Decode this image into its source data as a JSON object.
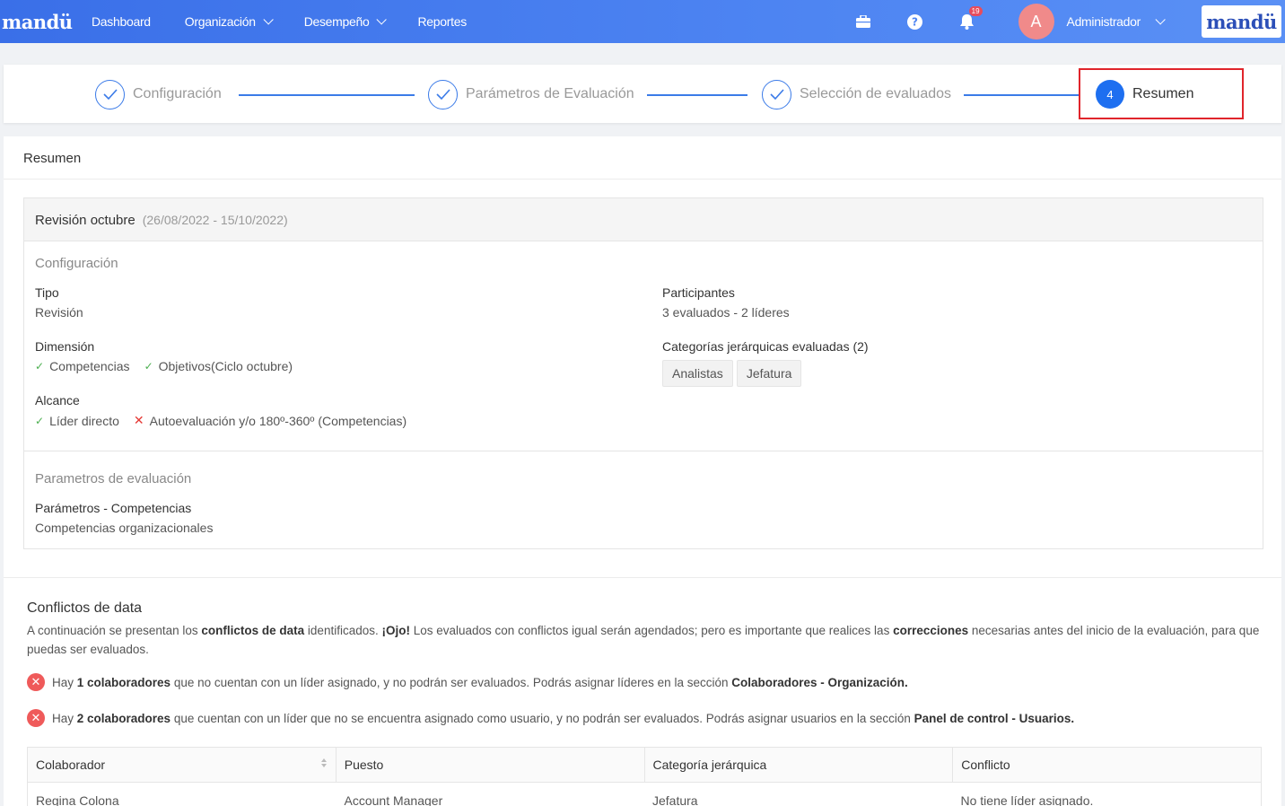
{
  "nav": {
    "brand": "mandü",
    "items": [
      {
        "label": "Dashboard",
        "dropdown": false
      },
      {
        "label": "Organización",
        "dropdown": true
      },
      {
        "label": "Desempeño",
        "dropdown": true
      },
      {
        "label": "Reportes",
        "dropdown": false
      }
    ],
    "notification_count": "19",
    "avatar_initial": "A",
    "user_name": "Administrador",
    "logo_text": "mandü"
  },
  "steps": [
    {
      "label": "Configuración",
      "state": "done"
    },
    {
      "label": "Parámetros de Evaluación",
      "state": "done"
    },
    {
      "label": "Selección de evaluados",
      "state": "done"
    },
    {
      "label": "Resumen",
      "number": "4",
      "state": "active"
    }
  ],
  "summary": {
    "title": "Resumen",
    "eval_name": "Revisión octubre",
    "eval_dates": "(26/08/2022 - 15/10/2022)",
    "config": {
      "section_title": "Configuración",
      "tipo_label": "Tipo",
      "tipo_value": "Revisión",
      "dimension_label": "Dimensión",
      "dimension_items": [
        "Competencias",
        "Objetivos(Ciclo octubre)"
      ],
      "alcance_label": "Alcance",
      "alcance_ok": "Líder directo",
      "alcance_no": "Autoevaluación y/o 180º-360º (Competencias)",
      "participantes_label": "Participantes",
      "participantes_value": "3 evaluados - 2 líderes",
      "categorias_label": "Categorías jerárquicas evaluadas (2)",
      "categorias_tags": [
        "Analistas",
        "Jefatura"
      ]
    },
    "params": {
      "section_title": "Parametros de evaluación",
      "label": "Parámetros - Competencias",
      "value": "Competencias organizacionales"
    }
  },
  "conflicts": {
    "title": "Conflictos de data",
    "desc": {
      "p1": "A continuación se presentan los ",
      "b1": "conflictos de data",
      "p2": " identificados. ",
      "b2": "¡Ojo!",
      "p3": " Los evaluados con conflictos igual serán agendados; pero es importante que realices las ",
      "b3": "correcciones",
      "p4": " necesarias antes del inicio de la evaluación, para que puedas ser evaluados."
    },
    "alert1": {
      "p1": "Hay ",
      "b1": "1 colaboradores",
      "p2": " que no cuentan con un líder asignado, y no podrán ser evaluados. Podrás asignar líderes en la sección ",
      "b2": "Colaboradores - Organización."
    },
    "alert2": {
      "p1": "Hay ",
      "b1": "2 colaboradores",
      "p2": " que cuentan con un líder que no se encuentra asignado como usuario, y no podrán ser evaluados. Podrás asignar usuarios en la sección ",
      "b2": "Panel de control - Usuarios."
    },
    "table": {
      "headers": [
        "Colaborador",
        "Puesto",
        "Categoría jerárquica",
        "Conflicto"
      ],
      "rows": [
        [
          "Regina Colona",
          "Account Manager",
          "Jefatura",
          "No tiene líder asignado."
        ]
      ]
    }
  },
  "colors": {
    "primary": "#3b7be8",
    "highlight_box": "#e0252b",
    "success": "#4caf50",
    "danger": "#ef5a5a"
  }
}
